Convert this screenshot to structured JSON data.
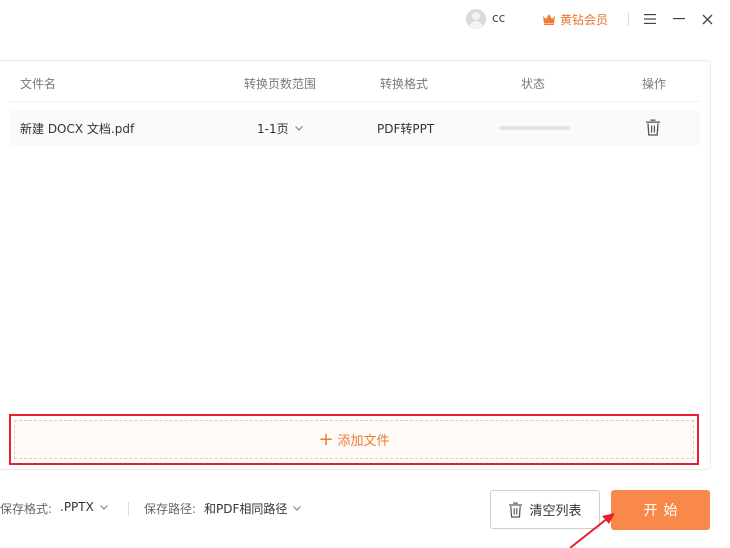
{
  "titlebar": {
    "username": "cc",
    "vip_label": "黄钻会员",
    "accent_color": "#e8742f"
  },
  "table": {
    "headers": {
      "filename": "文件名",
      "page_range": "转换页数范围",
      "format": "转换格式",
      "status": "状态",
      "action": "操作"
    },
    "rows": [
      {
        "filename": "新建 DOCX 文档.pdf",
        "page_range": "1-1页",
        "format": "PDF转PPT",
        "progress": 0
      }
    ]
  },
  "add_file": {
    "label": "添加文件"
  },
  "bottom": {
    "save_format_label": "保存格式:",
    "save_format_value": ".PPTX",
    "save_path_label": "保存路径:",
    "save_path_value": "和PDF相同路径",
    "clear_label": "清空列表",
    "start_label": "开始"
  },
  "colors": {
    "primary": "#f9894a",
    "highlight_border": "#e8202c"
  }
}
